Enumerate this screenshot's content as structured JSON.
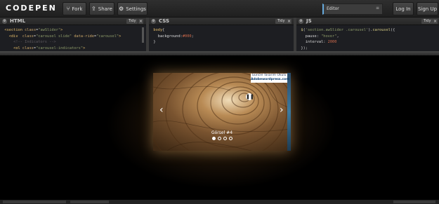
{
  "app": {
    "logo": "CODEPEN"
  },
  "toolbar": {
    "fork_label": "Fork",
    "fork_icon": "fork-icon",
    "share_label": "Share",
    "share_icon": "share-icon",
    "settings_label": "Settings",
    "settings_icon": "gear-icon",
    "view_select": "Editor",
    "login_label": "Log In",
    "signup_label": "Sign Up"
  },
  "editors": {
    "html": {
      "title": "HTML",
      "tidy": "Tidy",
      "close": "×"
    },
    "css": {
      "title": "CSS",
      "tidy": "Tidy",
      "close": "×"
    },
    "js": {
      "title": "JS",
      "tidy": "Tidy",
      "close": "×"
    }
  },
  "code": {
    "html": [
      "<section class=\"awSlider\">",
      "  <div  class=\"carousel slide\" data-ride=\"carousel\">",
      "    <!-- Indicators -->",
      "    <ol class=\"carousel-indicators\">"
    ],
    "css": [
      "body{",
      "  background:#000;",
      "}"
    ],
    "js": [
      "$('section.awSlider .carousel').carousel({",
      "  pause: \"hover\",",
      "  interval: 2000",
      "});"
    ]
  },
  "preview": {
    "badge_line1": "Güncel Tasarım Okulu",
    "badge_line2": "Adobewordpress.com",
    "prev_arrow": "‹",
    "next_arrow": "›",
    "caption": "Görsel #4",
    "indicators": 4,
    "active_indicator": 0,
    "pause_icon": "pause-icon"
  },
  "colors": {
    "accent": "#66aadd",
    "background": "#000000",
    "toolbar": "#2a2a2a"
  }
}
